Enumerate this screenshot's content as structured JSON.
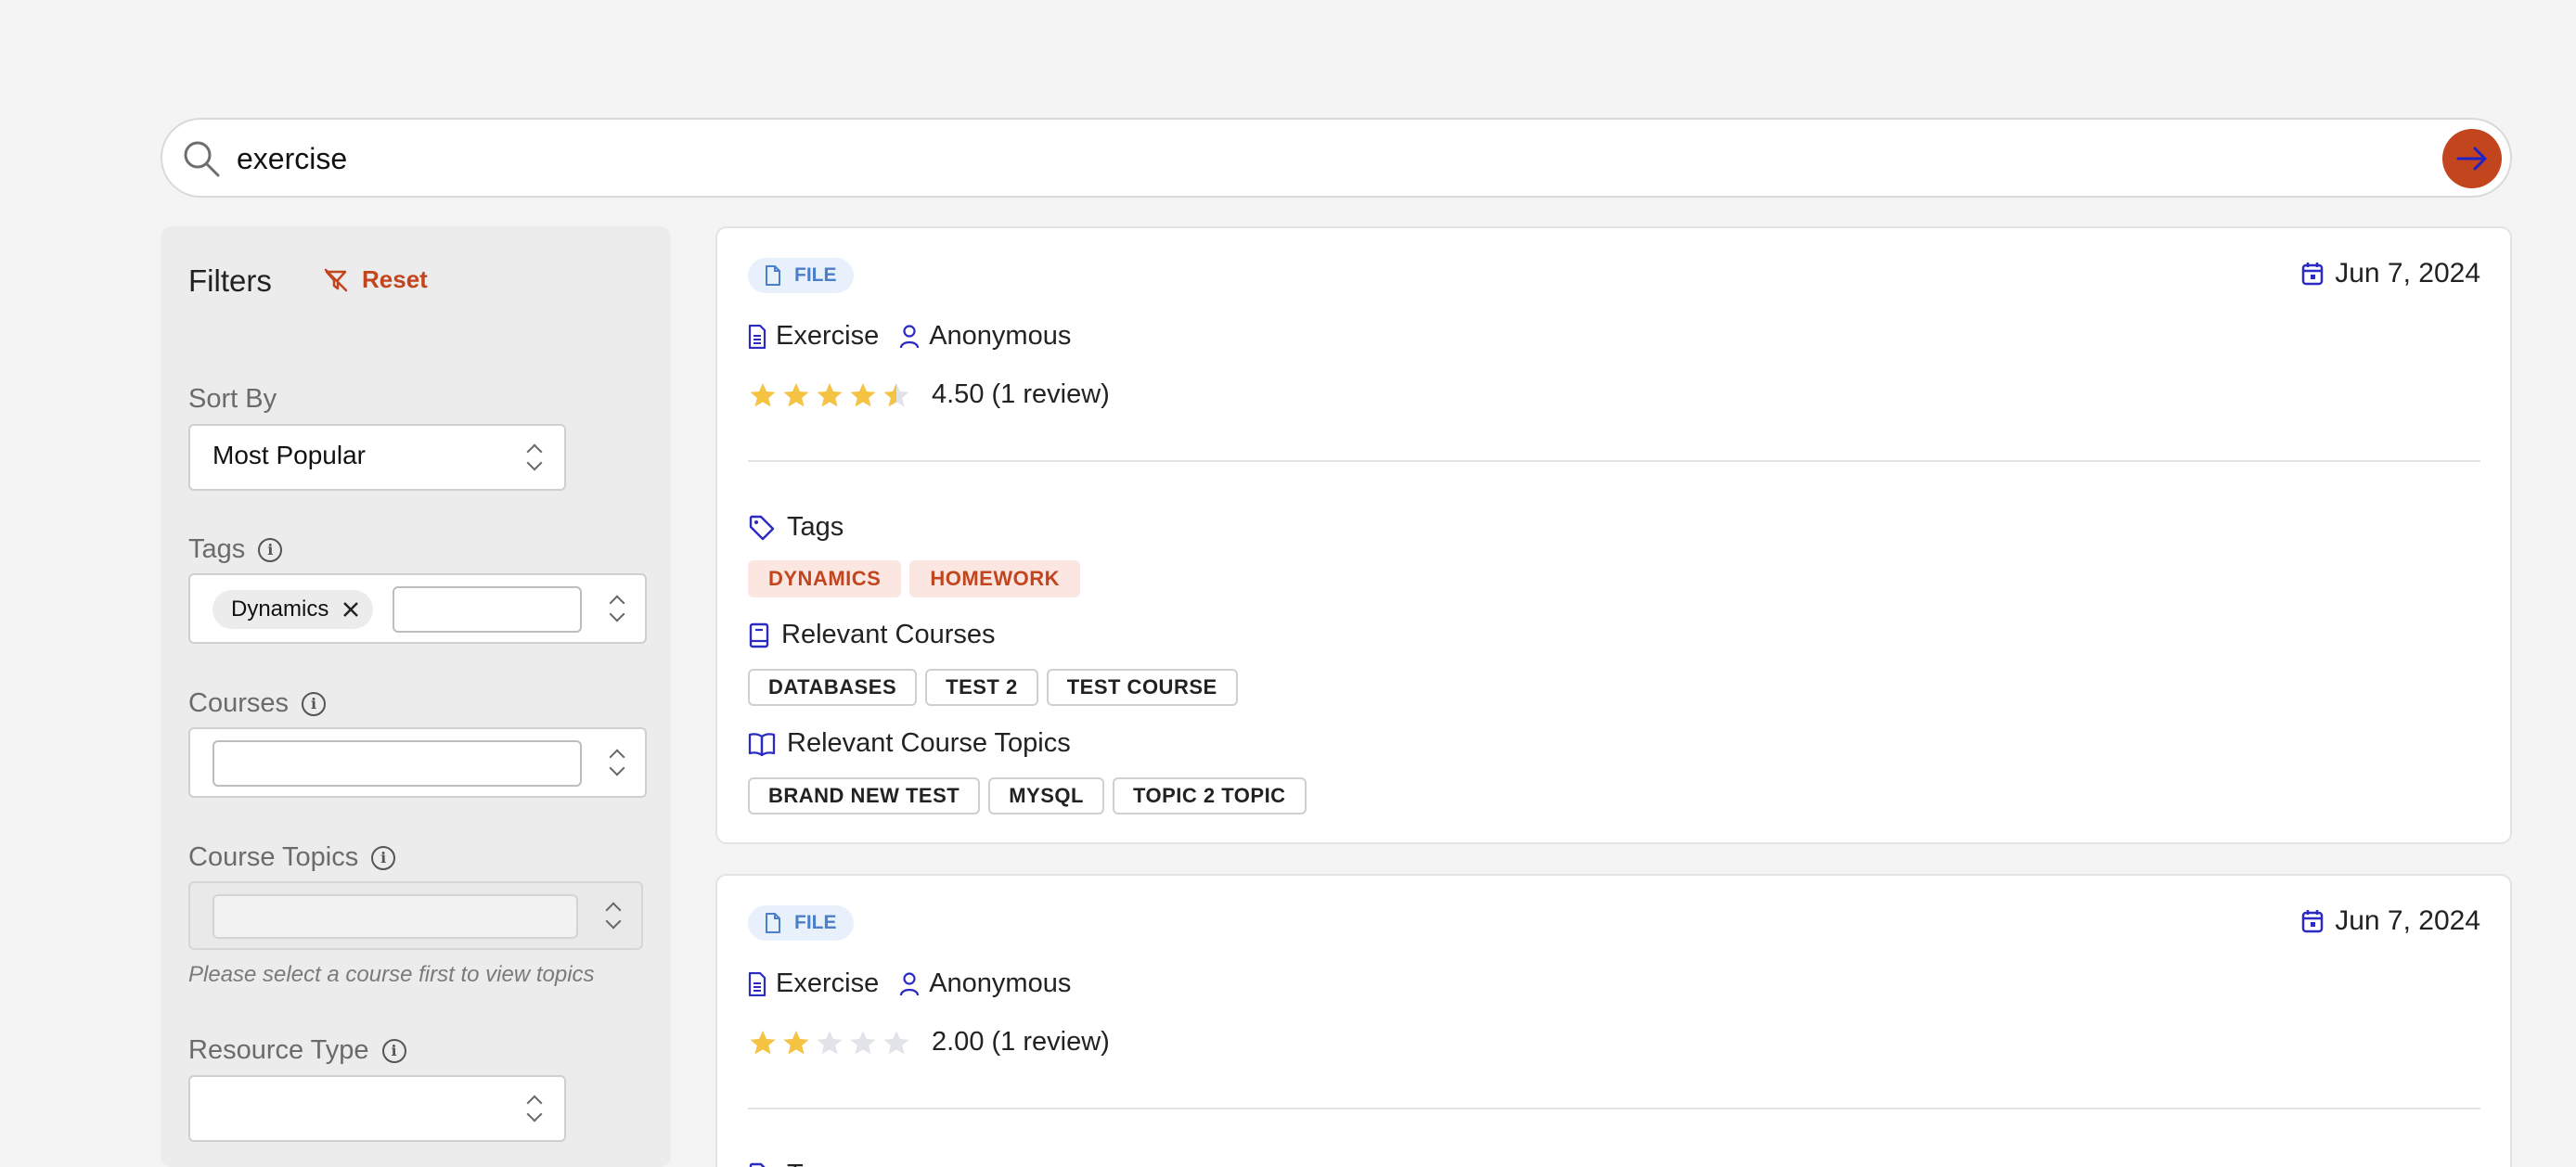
{
  "search": {
    "value": "exercise",
    "placeholder": ""
  },
  "filters": {
    "title": "Filters",
    "reset_label": "Reset",
    "sort_by": {
      "label": "Sort By",
      "value": "Most Popular"
    },
    "tags": {
      "label": "Tags",
      "selected": [
        "Dynamics"
      ]
    },
    "courses": {
      "label": "Courses"
    },
    "course_topics": {
      "label": "Course Topics",
      "hint": "Please select a course first to view topics"
    },
    "resource_type": {
      "label": "Resource Type"
    }
  },
  "results": [
    {
      "type_badge": "FILE",
      "date": "Jun 7, 2024",
      "title": "Exercise",
      "author": "Anonymous",
      "rating": 4.5,
      "rating_text": "4.50 (1 review)",
      "tags_heading": "Tags",
      "tags": [
        "DYNAMICS",
        "HOMEWORK"
      ],
      "courses_heading": "Relevant Courses",
      "courses": [
        "DATABASES",
        "TEST 2",
        "TEST COURSE"
      ],
      "topics_heading": "Relevant Course Topics",
      "topics": [
        "BRAND NEW TEST",
        "MYSQL",
        "TOPIC 2 TOPIC"
      ]
    },
    {
      "type_badge": "FILE",
      "date": "Jun 7, 2024",
      "title": "Exercise",
      "author": "Anonymous",
      "rating": 2,
      "rating_text": "2.00 (1 review)",
      "tags_heading": "Tags"
    }
  ],
  "colors": {
    "accent": "#c2451e",
    "icon_blue": "#2b2bc4",
    "star": "#f5c342",
    "star_empty": "#e1e3e8",
    "badge_blue": "#4b7fc9"
  }
}
